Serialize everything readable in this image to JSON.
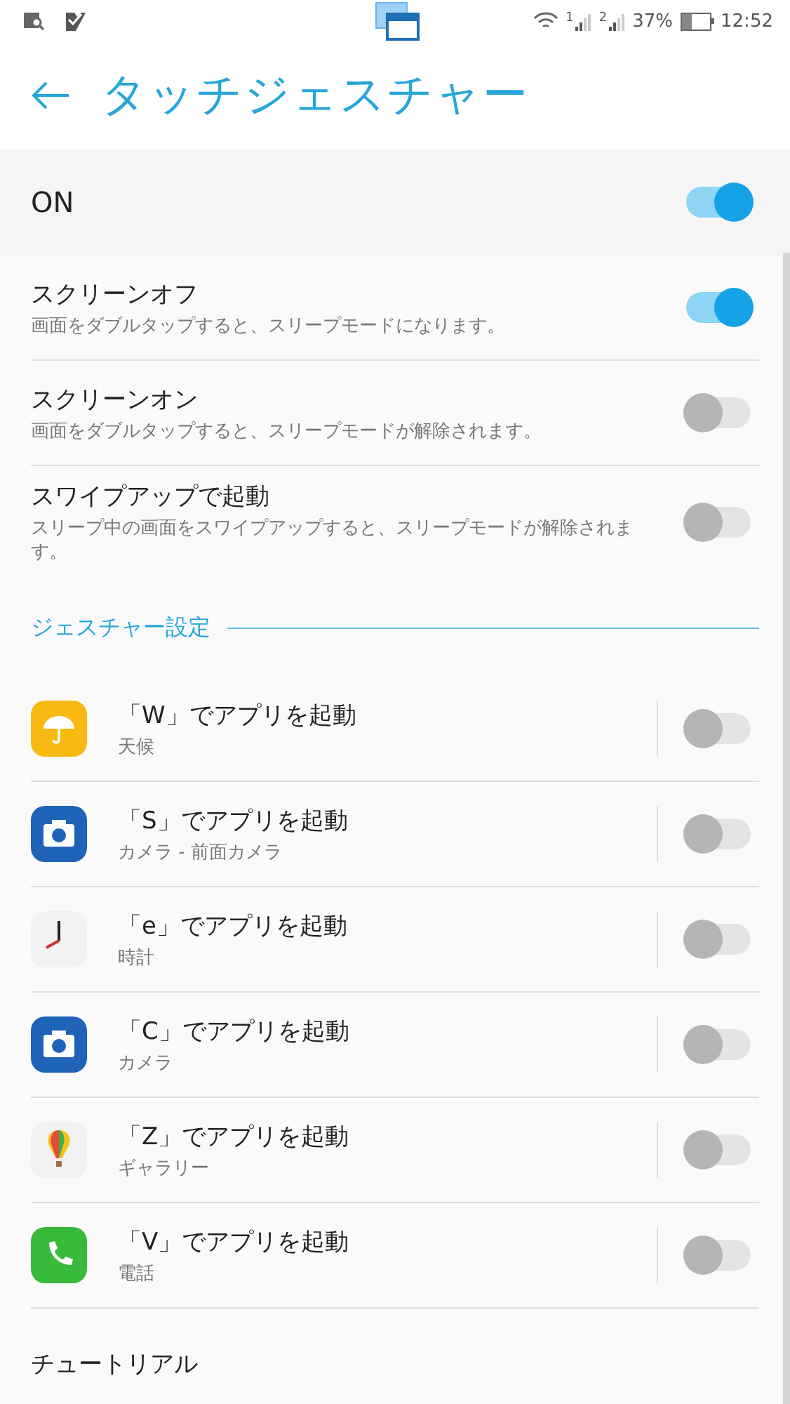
{
  "status_bar": {
    "sim_1": "1",
    "sim_2": "2",
    "battery": {
      "percent": "37%",
      "level": 0.37
    },
    "time": "12:52"
  },
  "header": {
    "title": "タッチジェスチャー"
  },
  "master": {
    "label": "ON",
    "on": true
  },
  "settings": [
    {
      "title": "スクリーンオフ",
      "description": "画面をダブルタップすると、スリープモードになります。",
      "on": true
    },
    {
      "title": "スクリーンオン",
      "description": "画面をダブルタップすると、スリープモードが解除されます。",
      "on": false
    },
    {
      "title": "スワイプアップで起動",
      "description": "スリープ中の画面をスワイプアップすると、スリープモードが解除されます。",
      "on": false
    }
  ],
  "section": {
    "title": "ジェスチャー設定"
  },
  "gestures": [
    {
      "kind": "weather",
      "title": "「W」でアプリを起動",
      "app": "天候",
      "on": false
    },
    {
      "kind": "camera",
      "title": "「S」でアプリを起動",
      "app": "カメラ - 前面カメラ",
      "on": false
    },
    {
      "kind": "clock",
      "title": "「e」でアプリを起動",
      "app": "時計",
      "on": false
    },
    {
      "kind": "camera",
      "title": "「C」でアプリを起動",
      "app": "カメラ",
      "on": false
    },
    {
      "kind": "gallery",
      "title": "「Z」でアプリを起動",
      "app": "ギャラリー",
      "on": false
    },
    {
      "kind": "phone",
      "title": "「V」でアプリを起動",
      "app": "電話",
      "on": false
    }
  ],
  "footer": {
    "title": "チュートリアル"
  }
}
